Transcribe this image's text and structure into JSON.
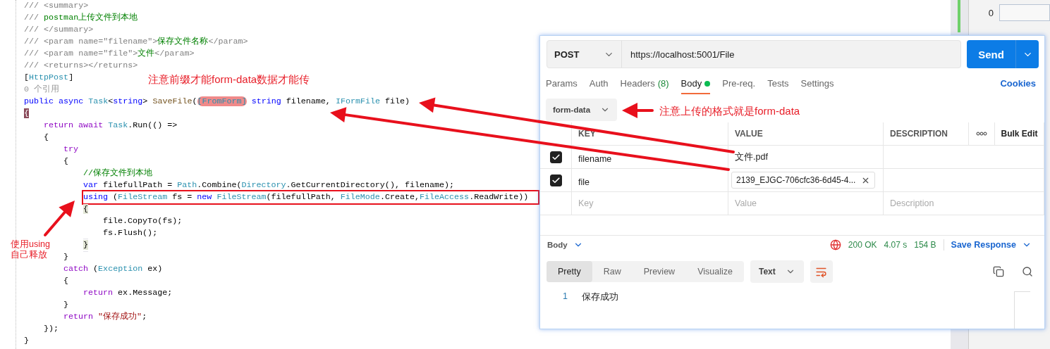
{
  "editor": {
    "lines": [
      {
        "tokens": [
          {
            "kind": "comment",
            "text": "/// <summary>"
          }
        ]
      },
      {
        "tokens": [
          {
            "kind": "comment",
            "text": "/// "
          },
          {
            "kind": "doc",
            "text": "postman上传文件到本地"
          }
        ]
      },
      {
        "tokens": [
          {
            "kind": "comment",
            "text": "/// </summary>"
          }
        ]
      },
      {
        "tokens": [
          {
            "kind": "comment",
            "text": "/// <param name=\"filename\">"
          },
          {
            "kind": "doc",
            "text": "保存文件名称"
          },
          {
            "kind": "comment",
            "text": "</param>"
          }
        ]
      },
      {
        "tokens": [
          {
            "kind": "comment",
            "text": "/// <param name=\"file\">"
          },
          {
            "kind": "doc",
            "text": "文件"
          },
          {
            "kind": "comment",
            "text": "</param>"
          }
        ]
      },
      {
        "tokens": [
          {
            "kind": "comment",
            "text": "/// <returns></returns>"
          }
        ]
      },
      {
        "tokens": [
          {
            "kind": "plain",
            "text": "["
          },
          {
            "kind": "type",
            "text": "HttpPost"
          },
          {
            "kind": "plain",
            "text": "]"
          }
        ]
      },
      {
        "tokens": [
          {
            "kind": "lens",
            "text": "0 个引用"
          }
        ]
      },
      {
        "tokens": [
          {
            "kind": "keyword",
            "text": "public async "
          },
          {
            "kind": "type",
            "text": "Task"
          },
          {
            "kind": "plain",
            "text": "<"
          },
          {
            "kind": "keyword",
            "text": "string"
          },
          {
            "kind": "plain",
            "text": "> "
          },
          {
            "kind": "method",
            "text": "SaveFile"
          },
          {
            "kind": "plain",
            "text": "("
          },
          {
            "kind": "marked",
            "text": "[FromForm]"
          },
          {
            "kind": "keyword",
            "text": " string "
          },
          {
            "kind": "plain",
            "text": "filename, "
          },
          {
            "kind": "type",
            "text": "IFormFile"
          },
          {
            "kind": "plain",
            "text": " file)"
          }
        ]
      },
      {
        "tokens": [
          {
            "kind": "brace-dark",
            "text": "{"
          }
        ]
      },
      {
        "tokens": [
          {
            "kind": "control",
            "text": "    return await "
          },
          {
            "kind": "type",
            "text": "Task"
          },
          {
            "kind": "plain",
            "text": ".Run(() =>"
          }
        ]
      },
      {
        "tokens": [
          {
            "kind": "plain",
            "text": "    {"
          }
        ]
      },
      {
        "tokens": [
          {
            "kind": "control",
            "text": "        try"
          }
        ]
      },
      {
        "tokens": [
          {
            "kind": "plain",
            "text": "        {"
          }
        ]
      },
      {
        "tokens": [
          {
            "kind": "doc",
            "text": "            //保存文件到本地"
          }
        ]
      },
      {
        "tokens": [
          {
            "kind": "keyword",
            "text": "            var "
          },
          {
            "kind": "plain",
            "text": "filefullPath = "
          },
          {
            "kind": "type",
            "text": "Path"
          },
          {
            "kind": "plain",
            "text": ".Combine("
          },
          {
            "kind": "type",
            "text": "Directory"
          },
          {
            "kind": "plain",
            "text": ".GetCurrentDirectory(), filename);"
          }
        ]
      },
      {
        "boxed": true,
        "tokens": [
          {
            "kind": "keyword",
            "text": "            using "
          },
          {
            "kind": "plain",
            "text": "("
          },
          {
            "kind": "type",
            "text": "FileStream"
          },
          {
            "kind": "plain",
            "text": " fs = "
          },
          {
            "kind": "keyword",
            "text": "new "
          },
          {
            "kind": "type",
            "text": "FileStream"
          },
          {
            "kind": "plain",
            "text": "(filefullPath, "
          },
          {
            "kind": "type",
            "text": "FileMode"
          },
          {
            "kind": "plain",
            "text": ".Create,"
          },
          {
            "kind": "type",
            "text": "FileAccess"
          },
          {
            "kind": "plain",
            "text": ".ReadWrite))"
          }
        ]
      },
      {
        "tokens": [
          {
            "kind": "brace-light",
            "text": "            {"
          }
        ]
      },
      {
        "tokens": [
          {
            "kind": "plain",
            "text": "                file.CopyTo(fs);"
          }
        ]
      },
      {
        "tokens": [
          {
            "kind": "plain",
            "text": "                fs.Flush();"
          }
        ]
      },
      {
        "current": true,
        "tokens": [
          {
            "kind": "brace-light",
            "text": "            }"
          }
        ]
      },
      {
        "tokens": [
          {
            "kind": "plain",
            "text": "        }"
          }
        ]
      },
      {
        "tokens": [
          {
            "kind": "control",
            "text": "        catch "
          },
          {
            "kind": "plain",
            "text": "("
          },
          {
            "kind": "type",
            "text": "Exception"
          },
          {
            "kind": "plain",
            "text": " ex)"
          }
        ]
      },
      {
        "tokens": [
          {
            "kind": "plain",
            "text": "        {"
          }
        ]
      },
      {
        "tokens": [
          {
            "kind": "control",
            "text": "            return "
          },
          {
            "kind": "plain",
            "text": "ex.Message;"
          }
        ]
      },
      {
        "tokens": [
          {
            "kind": "plain",
            "text": "        }"
          }
        ]
      },
      {
        "tokens": [
          {
            "kind": "control",
            "text": "        return "
          },
          {
            "kind": "string",
            "text": "\"保存成功\""
          },
          {
            "kind": "plain",
            "text": ";"
          }
        ]
      },
      {
        "tokens": [
          {
            "kind": "plain",
            "text": "    });"
          }
        ]
      },
      {
        "tokens": [
          {
            "kind": "plain",
            "text": "}"
          }
        ]
      }
    ]
  },
  "side_panel": {
    "value": "0"
  },
  "annotations": {
    "prefix_note": "注意前缀才能form-data数据才能传",
    "format_note": "注意上传的格式就是form-data",
    "using_note": [
      "使用using",
      "自己释放"
    ]
  },
  "postman": {
    "method": "POST",
    "url": "https://localhost:5001/File",
    "send": "Send",
    "tabs": [
      {
        "label": "Params",
        "selected": false
      },
      {
        "label": "Auth",
        "selected": false
      },
      {
        "label": "Headers",
        "count": "(8)",
        "selected": false
      },
      {
        "label": "Body",
        "selected": true,
        "dot": true
      },
      {
        "label": "Pre-req.",
        "selected": false
      },
      {
        "label": "Tests",
        "selected": false
      },
      {
        "label": "Settings",
        "selected": false
      }
    ],
    "cookies": "Cookies",
    "body_type": "form-data",
    "table": {
      "columns": [
        "KEY",
        "VALUE",
        "DESCRIPTION"
      ],
      "bulk_edit": "Bulk Edit",
      "rows": [
        {
          "checked": true,
          "key": "filename",
          "value": "文件.pdf",
          "kind": "text"
        },
        {
          "checked": true,
          "key": "file",
          "value": "2139_EJGC-706cfc36-6d45-4...",
          "kind": "file"
        }
      ],
      "new_row": [
        {
          "placeholder": "Key"
        },
        {
          "placeholder": "Value"
        },
        {
          "placeholder": "Description"
        }
      ]
    },
    "response": {
      "label": "Body",
      "status": "200 OK",
      "time": "4.07 s",
      "size": "154 B",
      "save": "Save Response",
      "views": [
        {
          "label": "Pretty",
          "selected": true
        },
        {
          "label": "Raw",
          "selected": false
        },
        {
          "label": "Preview",
          "selected": false
        },
        {
          "label": "Visualize",
          "selected": false
        }
      ],
      "format": "Text",
      "lines": [
        {
          "number": "1",
          "text": "保存成功"
        }
      ]
    }
  }
}
